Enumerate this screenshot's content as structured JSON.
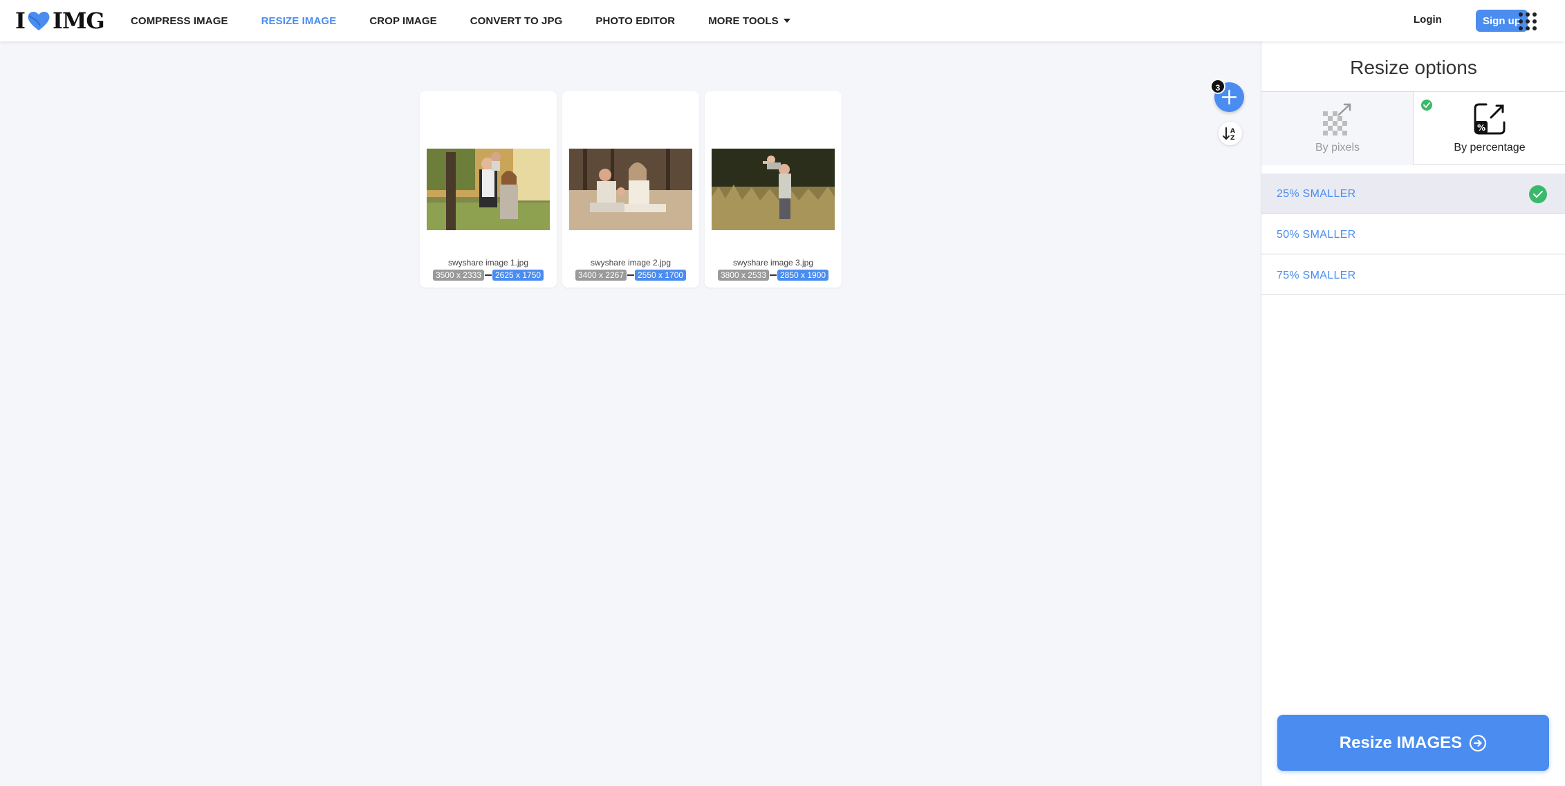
{
  "header": {
    "logo_left": "I",
    "logo_right": "IMG",
    "nav": [
      {
        "label": "COMPRESS IMAGE",
        "active": false
      },
      {
        "label": "RESIZE IMAGE",
        "active": true
      },
      {
        "label": "CROP IMAGE",
        "active": false
      },
      {
        "label": "CONVERT TO JPG",
        "active": false
      },
      {
        "label": "PHOTO EDITOR",
        "active": false
      },
      {
        "label": "MORE TOOLS",
        "active": false
      }
    ],
    "login": "Login",
    "signup": "Sign up"
  },
  "files": [
    {
      "name": "swyshare image 1.jpg",
      "original": "3500 x 2333",
      "resized": "2625 x 1750"
    },
    {
      "name": "swyshare image 2.jpg",
      "original": "3400 x 2267",
      "resized": "2550 x 1700"
    },
    {
      "name": "swyshare image 3.jpg",
      "original": "3800 x 2533",
      "resized": "2850 x 1900"
    }
  ],
  "file_count": "3",
  "sidebar": {
    "title": "Resize options",
    "modes": [
      {
        "label": "By pixels",
        "selected": false
      },
      {
        "label": "By percentage",
        "selected": true
      }
    ],
    "options": [
      {
        "label": "25% SMALLER",
        "selected": true
      },
      {
        "label": "50% SMALLER",
        "selected": false
      },
      {
        "label": "75% SMALLER",
        "selected": false
      }
    ],
    "action": "Resize IMAGES"
  },
  "colors": {
    "accent": "#4a8cf0",
    "success": "#3bb96a"
  }
}
